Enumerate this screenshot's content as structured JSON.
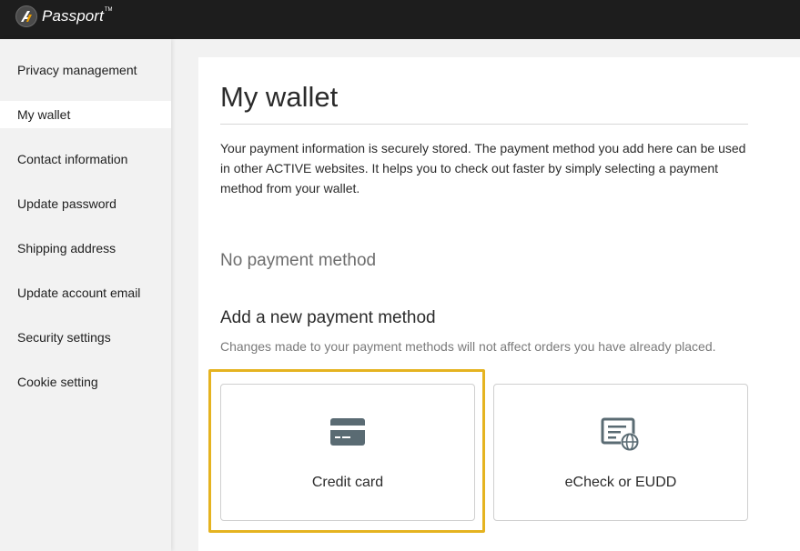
{
  "header": {
    "brand_name": "Passport",
    "brand_tm": "TM",
    "logo_icon": "passport-a-icon",
    "background": "#1d1d1d"
  },
  "sidebar": {
    "items": [
      {
        "label": "Privacy management",
        "active": false
      },
      {
        "label": "My wallet",
        "active": true
      },
      {
        "label": "Contact information",
        "active": false
      },
      {
        "label": "Update password",
        "active": false
      },
      {
        "label": "Shipping address",
        "active": false
      },
      {
        "label": "Update account email",
        "active": false
      },
      {
        "label": "Security settings",
        "active": false
      },
      {
        "label": "Cookie setting",
        "active": false
      }
    ]
  },
  "main": {
    "title": "My wallet",
    "intro": "Your payment information is securely stored. The payment method you add here can be used in other ACTIVE websites. It helps you to check out faster by simply selecting a payment method from your wallet.",
    "empty_state": "No payment method",
    "add_heading": "Add a new payment method",
    "add_note": "Changes made to your payment methods will not affect orders you have already placed.",
    "payment_options": [
      {
        "label": "Credit card",
        "icon": "credit-card-icon",
        "highlighted": true
      },
      {
        "label": "eCheck or EUDD",
        "icon": "echeck-globe-icon",
        "highlighted": false
      }
    ]
  },
  "colors": {
    "highlight": "#e5b320",
    "icon": "#5a6b73"
  }
}
